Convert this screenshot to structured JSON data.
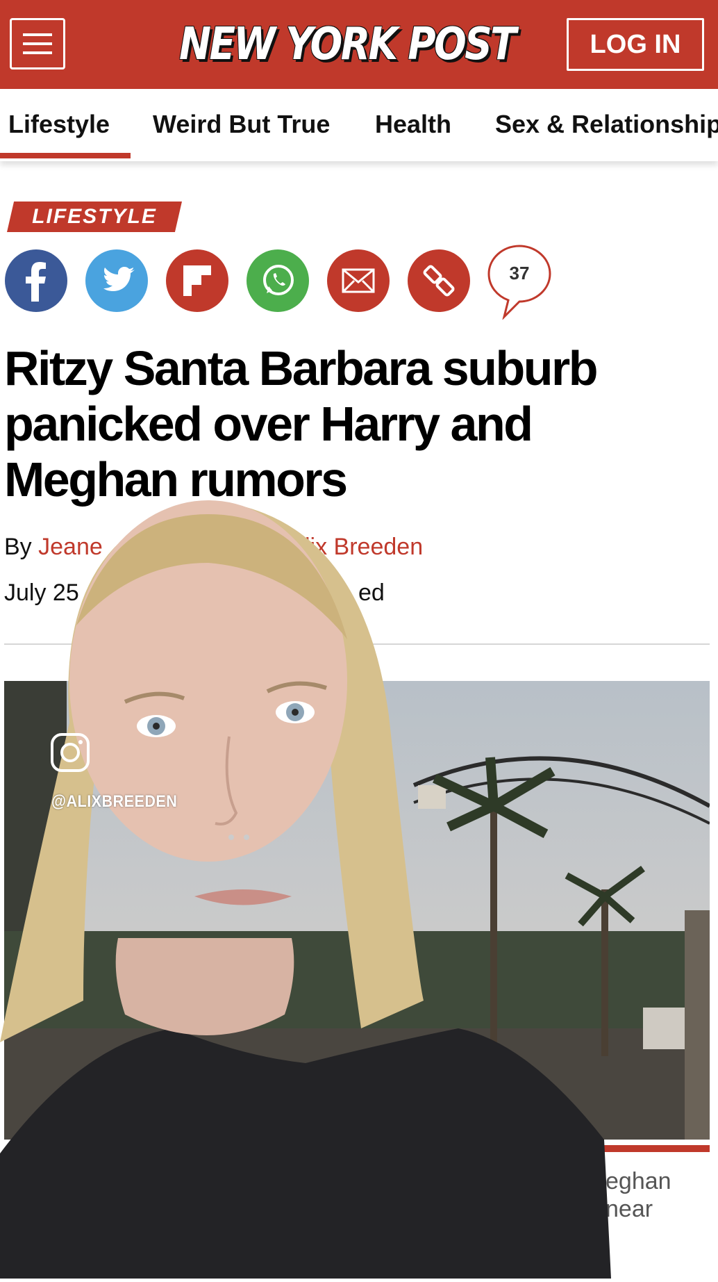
{
  "header": {
    "logo": "NEW YORK POST",
    "login_label": "LOG IN",
    "menu_icon": "hamburger-menu-icon",
    "background_color": "#c0392b"
  },
  "nav": {
    "tabs": [
      {
        "label": "Lifestyle",
        "active": true
      },
      {
        "label": "Weird But True"
      },
      {
        "label": "Health"
      },
      {
        "label": "Sex & Relationships"
      }
    ]
  },
  "article": {
    "section_tag": "LIFESTYLE",
    "share": [
      {
        "icon": "facebook-icon",
        "color": "#3b5998"
      },
      {
        "icon": "twitter-icon",
        "color": "#4aa3df"
      },
      {
        "icon": "flipboard-icon",
        "color": "#c0392b"
      },
      {
        "icon": "whatsapp-icon",
        "color": "#4cae4c"
      },
      {
        "icon": "email-icon",
        "color": "#c0392b"
      },
      {
        "icon": "link-icon",
        "color": "#c0392b"
      }
    ],
    "comment_count": "37",
    "headline": "Ritzy Santa Barbara suburb panicked over Harry and Meghan rumors",
    "byline_prefix": "By",
    "author_1": "Jeane",
    "author_2": "lix Breeden",
    "date_start": "July 25",
    "date_end": "ed",
    "caption_line_1": "eghan",
    "caption_line_2": "near"
  },
  "overlay": {
    "ig_icon": "instagram-icon",
    "handle": "@ALIXBREEDEN"
  }
}
